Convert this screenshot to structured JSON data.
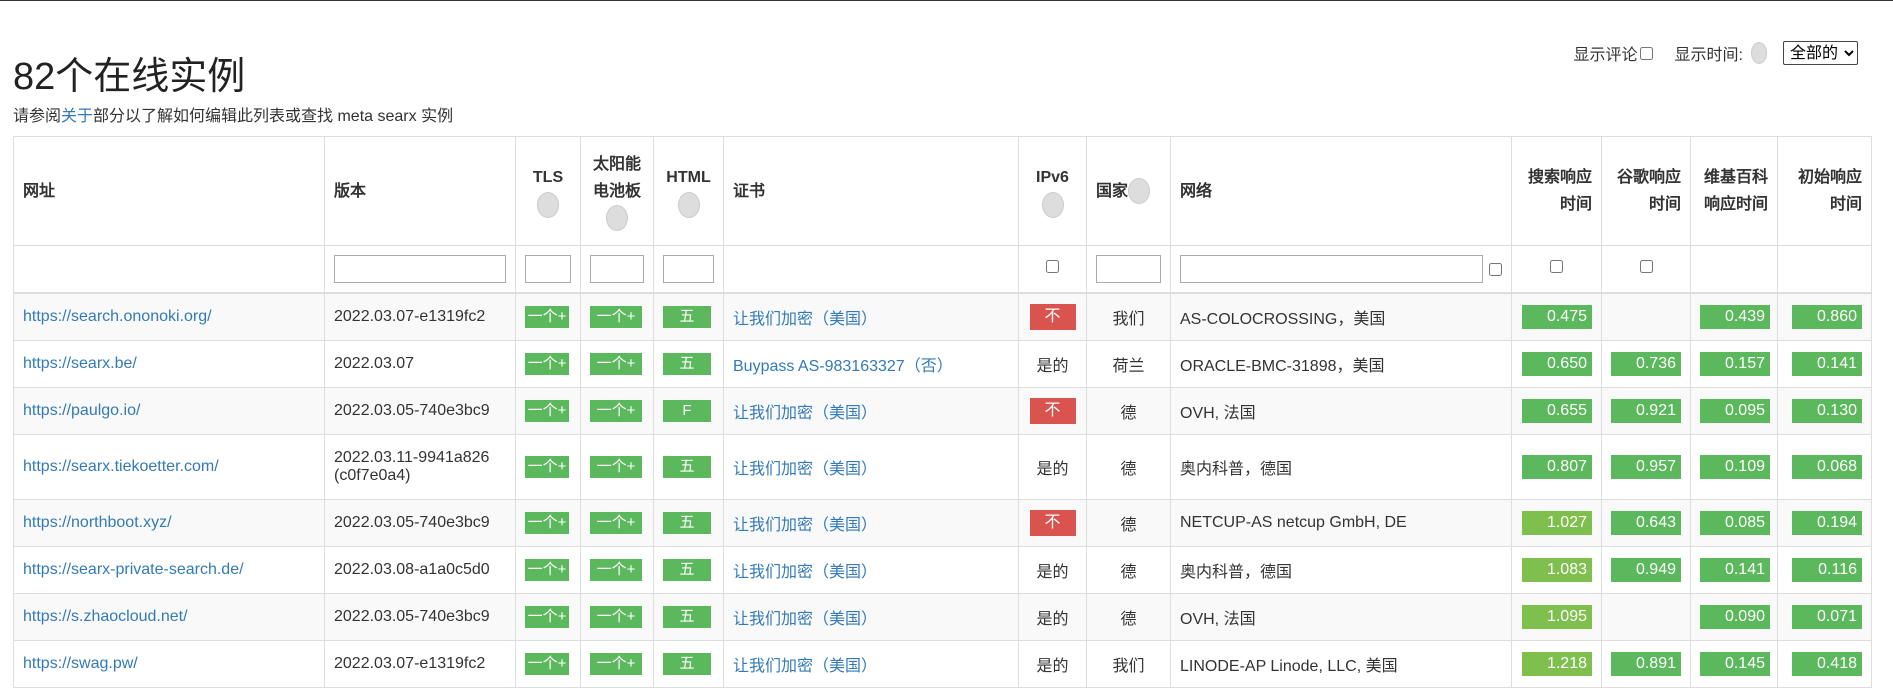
{
  "header": {
    "title": "82个在线实例",
    "subtitle_prefix": "请参阅",
    "subtitle_link": "关于",
    "subtitle_suffix": "部分以了解如何编辑此列表或查找 meta searx 实例"
  },
  "controls": {
    "show_comments_label": "显示评论",
    "show_time_label": "显示时间:",
    "time_select_value": "全部的"
  },
  "columns": {
    "url": "网址",
    "version": "版本",
    "tls": "TLS",
    "solar": "太阳能电池板",
    "html": "HTML",
    "cert": "证书",
    "ipv6": "IPv6",
    "country": "国家",
    "network": "网络",
    "search_rt": "搜索响应时间",
    "google_rt": "谷歌响应时间",
    "wiki_rt": "维基百科响应时间",
    "initial_rt": "初始响应时间"
  },
  "rows": [
    {
      "url": "https://search.ononoki.org/",
      "version": "2022.03.07-e1319fc2",
      "tls": "一个+",
      "solar": "一个+",
      "html": "五",
      "cert": "让我们加密（美国）",
      "ipv6": "不",
      "country": "我们",
      "network": "AS-COLOCROSSING，美国",
      "search": "0.475",
      "google": "",
      "wiki": "0.439",
      "initial": "0.860"
    },
    {
      "url": "https://searx.be/",
      "version": "2022.03.07",
      "tls": "一个+",
      "solar": "一个+",
      "html": "五",
      "cert": "Buypass AS-983163327（否）",
      "ipv6": "是的",
      "country": "荷兰",
      "network": "ORACLE-BMC-31898，美国",
      "search": "0.650",
      "google": "0.736",
      "wiki": "0.157",
      "initial": "0.141"
    },
    {
      "url": "https://paulgo.io/",
      "version": "2022.03.05-740e3bc9",
      "tls": "一个+",
      "solar": "一个+",
      "html": "F",
      "cert": "让我们加密（美国）",
      "ipv6": "不",
      "country": "德",
      "network": "OVH, 法国",
      "search": "0.655",
      "google": "0.921",
      "wiki": "0.095",
      "initial": "0.130"
    },
    {
      "url": "https://searx.tiekoetter.com/",
      "version": "2022.03.11-9941a826 (c0f7e0a4)",
      "tls": "一个+",
      "solar": "一个+",
      "html": "五",
      "cert": "让我们加密（美国）",
      "ipv6": "是的",
      "country": "德",
      "network": "奥内科普，德国",
      "search": "0.807",
      "google": "0.957",
      "wiki": "0.109",
      "initial": "0.068"
    },
    {
      "url": "https://northboot.xyz/",
      "version": "2022.03.05-740e3bc9",
      "tls": "一个+",
      "solar": "一个+",
      "html": "五",
      "cert": "让我们加密（美国）",
      "ipv6": "不",
      "country": "德",
      "network": "NETCUP-AS netcup GmbH, DE",
      "search": "1.027",
      "google": "0.643",
      "wiki": "0.085",
      "initial": "0.194"
    },
    {
      "url": "https://searx-private-search.de/",
      "version": "2022.03.08-a1a0c5d0",
      "tls": "一个+",
      "solar": "一个+",
      "html": "五",
      "cert": "让我们加密（美国）",
      "ipv6": "是的",
      "country": "德",
      "network": "奥内科普，德国",
      "search": "1.083",
      "google": "0.949",
      "wiki": "0.141",
      "initial": "0.116"
    },
    {
      "url": "https://s.zhaocloud.net/",
      "version": "2022.03.05-740e3bc9",
      "tls": "一个+",
      "solar": "一个+",
      "html": "五",
      "cert": "让我们加密（美国）",
      "ipv6": "是的",
      "country": "德",
      "network": "OVH, 法国",
      "search": "1.095",
      "google": "",
      "wiki": "0.090",
      "initial": "0.071"
    },
    {
      "url": "https://swag.pw/",
      "version": "2022.03.07-e1319fc2",
      "tls": "一个+",
      "solar": "一个+",
      "html": "五",
      "cert": "让我们加密（美国）",
      "ipv6": "是的",
      "country": "我们",
      "network": "LINODE-AP Linode, LLC, 美国",
      "search": "1.218",
      "google": "0.891",
      "wiki": "0.145",
      "initial": "0.418"
    }
  ],
  "colors": {
    "green": "#5cb85c",
    "lime": "#7fbf4d",
    "red": "#d9534f",
    "link": "#337ab7"
  }
}
